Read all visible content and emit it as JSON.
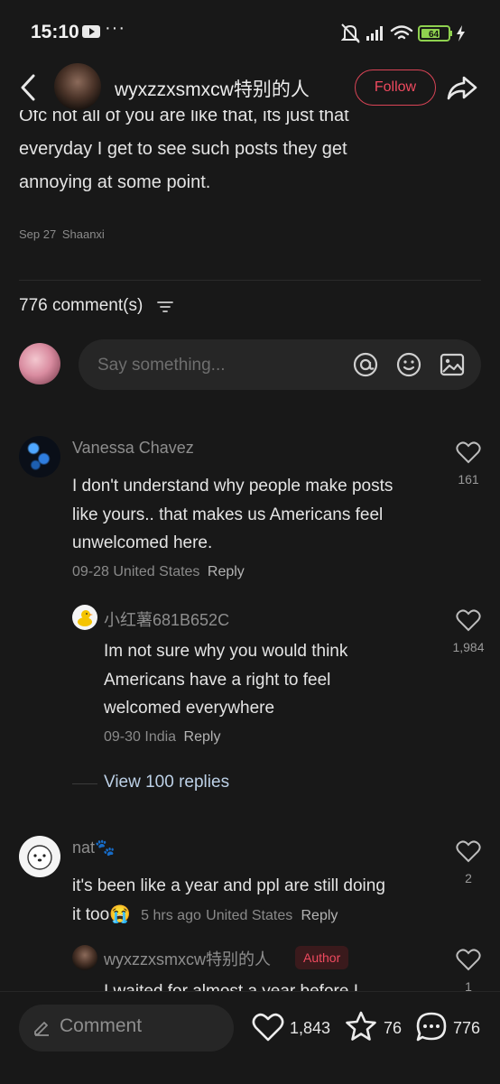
{
  "status": {
    "time": "15:10",
    "battery": "64"
  },
  "header": {
    "username": "wyxzzxsmxcw特别的人",
    "follow_label": "Follow"
  },
  "post": {
    "text_lines": [
      "Ofc not all of you are like that, its just that",
      "everyday I get to see such posts they get",
      "annoying at some point."
    ],
    "date": "Sep 27",
    "location": "Shaanxi"
  },
  "comments_header": {
    "count_label": "776 comment(s)"
  },
  "input": {
    "placeholder": "Say something..."
  },
  "comments": [
    {
      "name": "Vanessa Chavez",
      "lines": [
        "I don't understand why people make posts",
        "like yours.. that makes us Americans feel",
        "unwelcomed here."
      ],
      "date": "09-28",
      "location": "United States",
      "reply": "Reply",
      "likes": "161"
    },
    {
      "name": "小红薯681B652C",
      "lines": [
        "Im not sure why you would think",
        "Americans have a right to feel",
        "welcomed everywhere"
      ],
      "date": "09-30",
      "location": "India",
      "reply": "Reply",
      "likes": "1,984"
    },
    {
      "name": "nat🐾",
      "lines": [
        "it's been like a year and ppl are still doing",
        "it too"
      ],
      "emoji": "😭",
      "date": "5 hrs ago",
      "location": "United States",
      "reply": "Reply",
      "likes": "2"
    },
    {
      "name": "wyxzzxsmxcw特别的人",
      "badge": "Author",
      "lines": [
        "I waited for almost a year before I"
      ],
      "likes": "1"
    }
  ],
  "view_replies": "View 100 replies",
  "bottom_bar": {
    "comment_label": "Comment",
    "likes": "1,843",
    "favorites": "76",
    "comments": "776"
  },
  "colors": {
    "accent": "#ef4a5f",
    "background": "#181818",
    "link": "#bcd0e6"
  }
}
